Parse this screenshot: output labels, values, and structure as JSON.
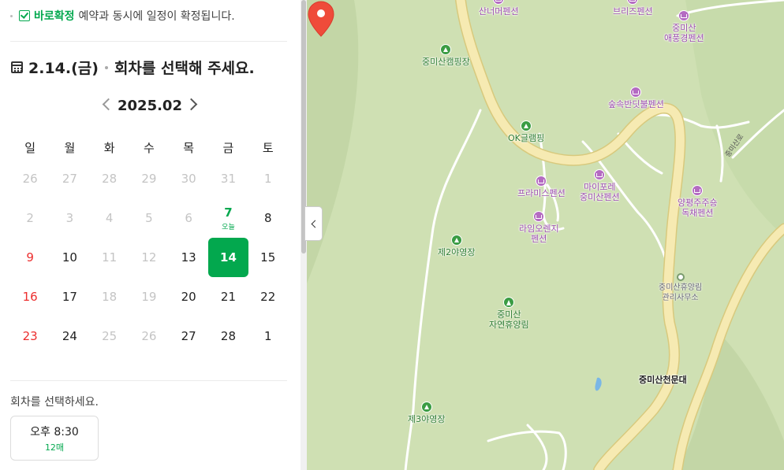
{
  "notice": {
    "strong": "바로확정",
    "text": "예약과 동시에 일정이 확정됩니다."
  },
  "selection": {
    "date": "2.14.(금)",
    "prompt": "회차를 선택해 주세요."
  },
  "calendar": {
    "month": "2025.02",
    "weekdays": [
      "일",
      "월",
      "화",
      "수",
      "목",
      "금",
      "토"
    ],
    "today_label": "오늘",
    "weeks": [
      [
        "26",
        "27",
        "28",
        "29",
        "30",
        "31",
        "1"
      ],
      [
        "2",
        "3",
        "4",
        "5",
        "6",
        "7",
        "8"
      ],
      [
        "9",
        "10",
        "11",
        "12",
        "13",
        "14",
        "15"
      ],
      [
        "16",
        "17",
        "18",
        "19",
        "20",
        "21",
        "22"
      ],
      [
        "23",
        "24",
        "25",
        "26",
        "27",
        "28",
        "1"
      ]
    ]
  },
  "times": {
    "label": "회차를 선택하세요.",
    "slots": [
      {
        "time": "오후 8:30",
        "count": "12매"
      }
    ]
  },
  "map": {
    "pois": {
      "p1": "산너머펜션",
      "p2": "브리즈펜션",
      "p3_1": "중미산",
      "p3_2": "애풍경펜션",
      "p4": "중미산캠핑장",
      "p5": "숲속반딧불펜션",
      "p6": "OK글램핑",
      "p7_1": "마이포레",
      "p7_2": "중미산펜션",
      "p8": "프라미스펜션",
      "p9_1": "양평주주숑",
      "p9_2": "독채펜션",
      "p10_1": "라임오렌지",
      "p10_2": "펜션",
      "p11": "제2야영장",
      "p12_1": "중미산휴양림",
      "p12_2": "관리사무소",
      "p13_1": "중미산",
      "p13_2": "자연휴양림",
      "p14": "중미산천문대",
      "p15": "제3야영장"
    },
    "road_label": "중미산로"
  },
  "colors": {
    "accent": "#03a84e",
    "sunday": "#ec2e2e",
    "map_bg": "#cfe0b3",
    "road": "#f4e6a8"
  }
}
